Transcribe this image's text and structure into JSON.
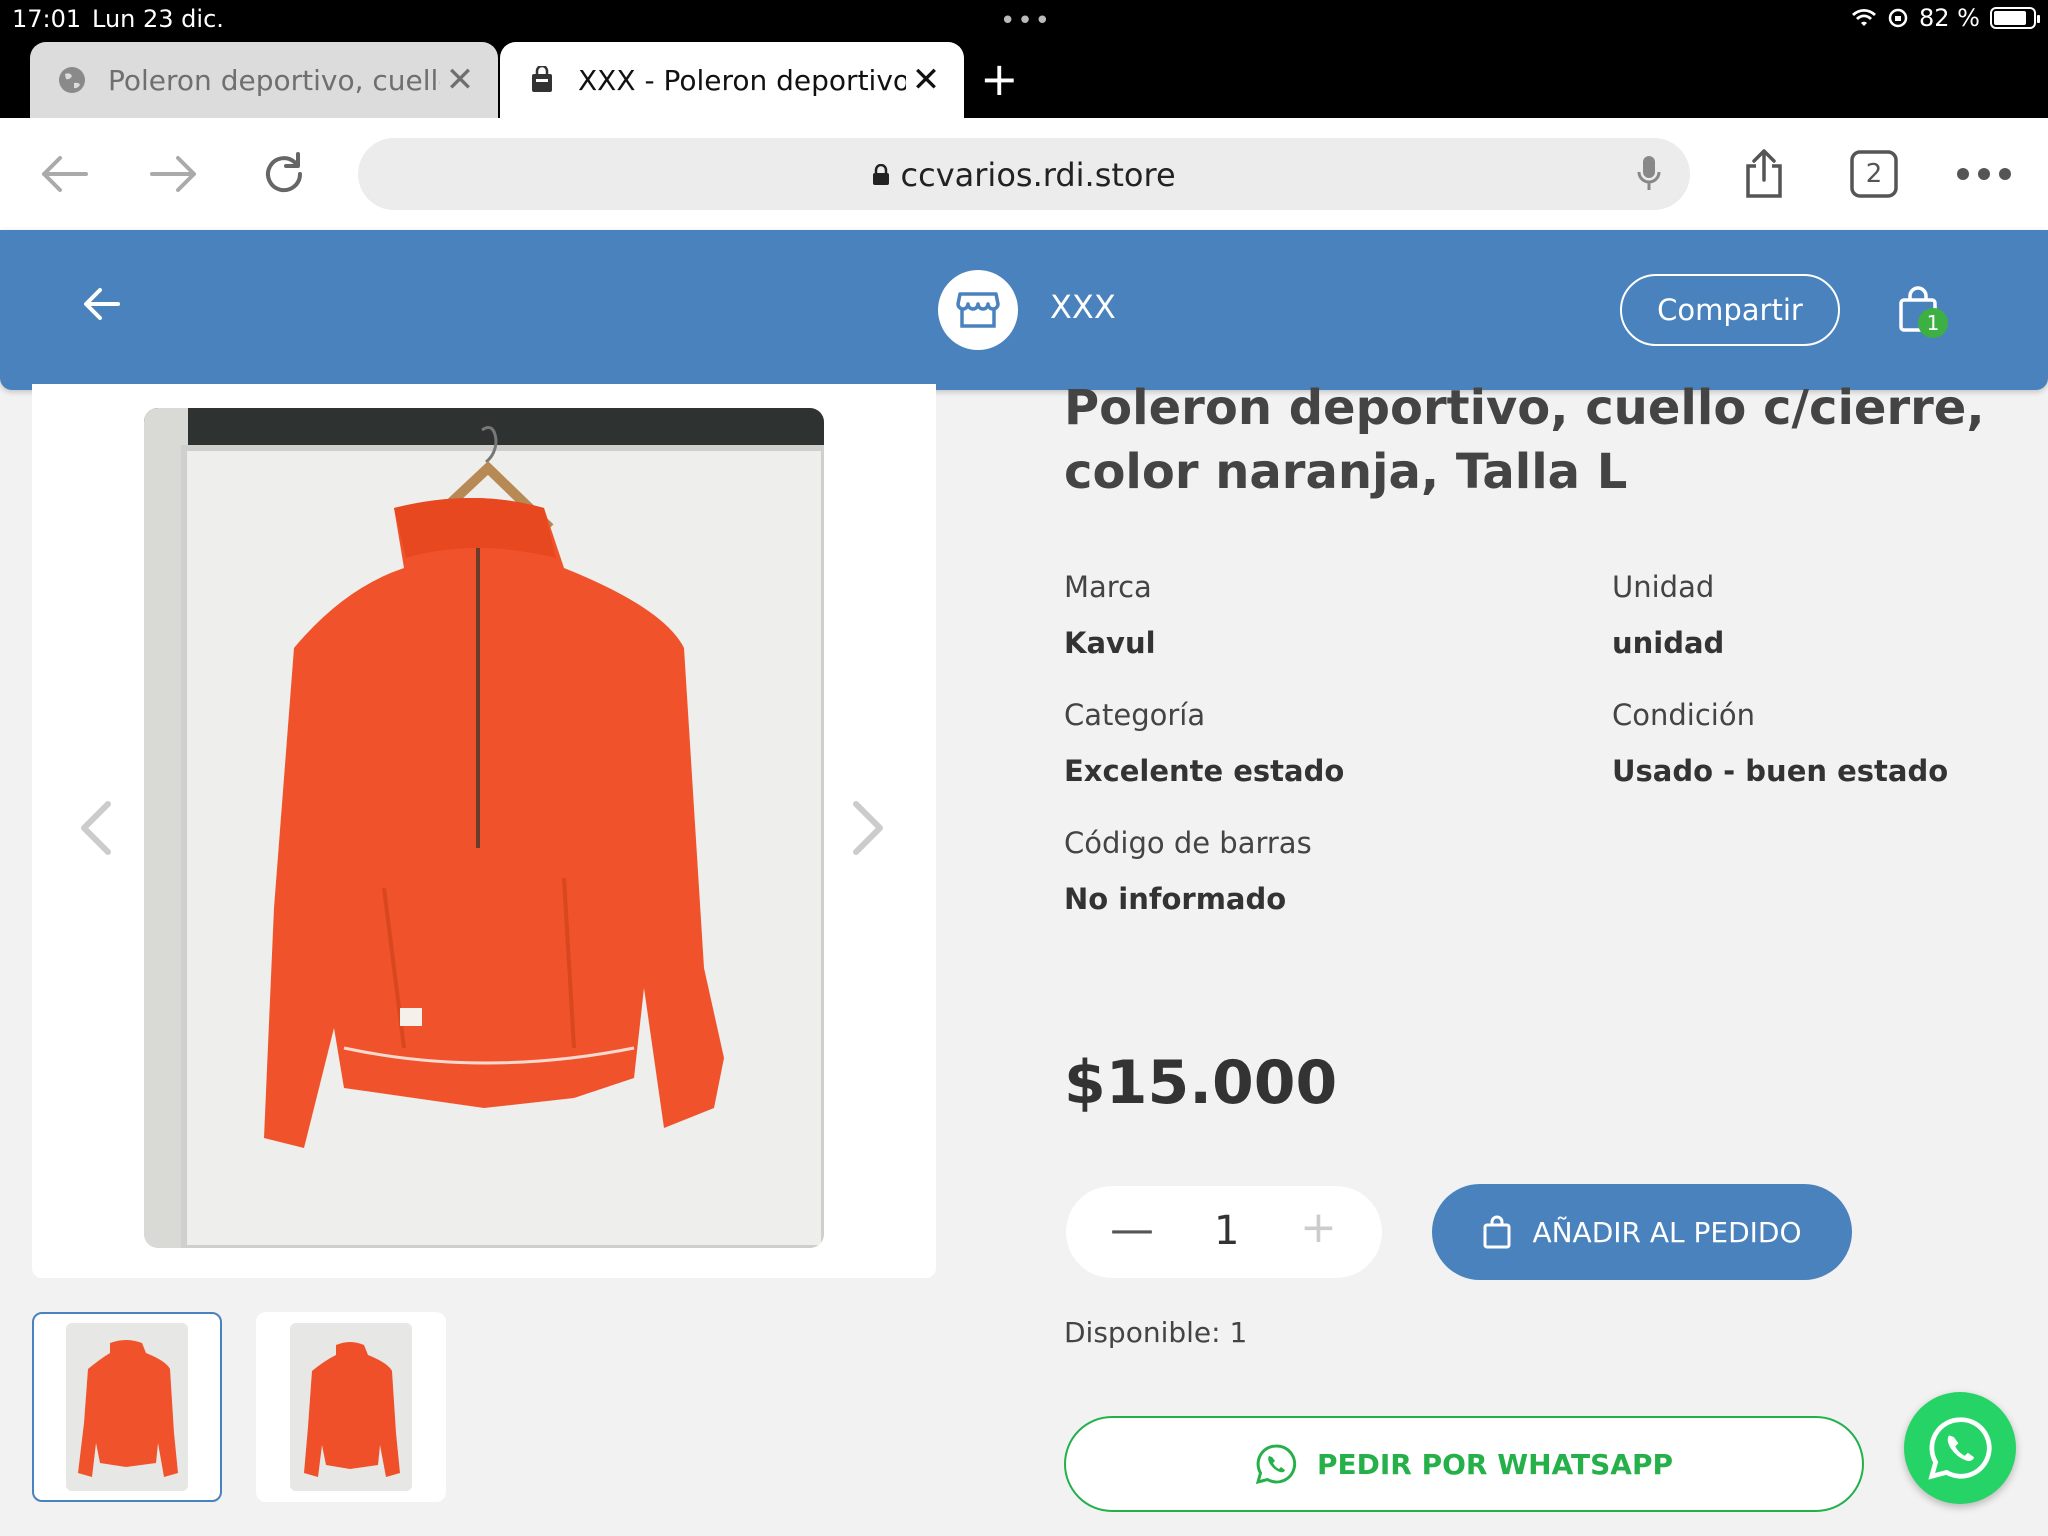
{
  "status_bar": {
    "time": "17:01",
    "date": "Lun 23 dic.",
    "battery": "82 %"
  },
  "browser": {
    "tabs": [
      {
        "title": "Poleron deportivo, cuello",
        "active": false
      },
      {
        "title": "XXX - Poleron deportivo,",
        "active": true
      }
    ],
    "url": "ccvarios.rdi.store",
    "tab_count": "2"
  },
  "header": {
    "store_name": "XXX",
    "share_label": "Compartir",
    "cart_count": "1"
  },
  "product": {
    "title": "Poleron deportivo, cuello c/cierre, color naranja, Talla L",
    "attributes": [
      {
        "label": "Marca",
        "value": "Kavul"
      },
      {
        "label": "Unidad",
        "value": "unidad"
      },
      {
        "label": "Categoría",
        "value": "Excelente estado"
      },
      {
        "label": "Condición",
        "value": "Usado - buen estado"
      },
      {
        "label": "Código de barras",
        "value": "No informado"
      }
    ],
    "price": "$15.000",
    "quantity": "1",
    "add_label": "AÑADIR AL PEDIDO",
    "available": "Disponible: 1",
    "whatsapp_label": "PEDIR POR WHATSAPP"
  },
  "colors": {
    "brand": "#4a82bd",
    "whatsapp": "#25d366",
    "garment": "#f0532b"
  },
  "icons": {
    "back": "arrow-left-icon",
    "store": "storefront-icon",
    "cart": "shopping-bag-icon",
    "whatsapp": "whatsapp-icon"
  }
}
